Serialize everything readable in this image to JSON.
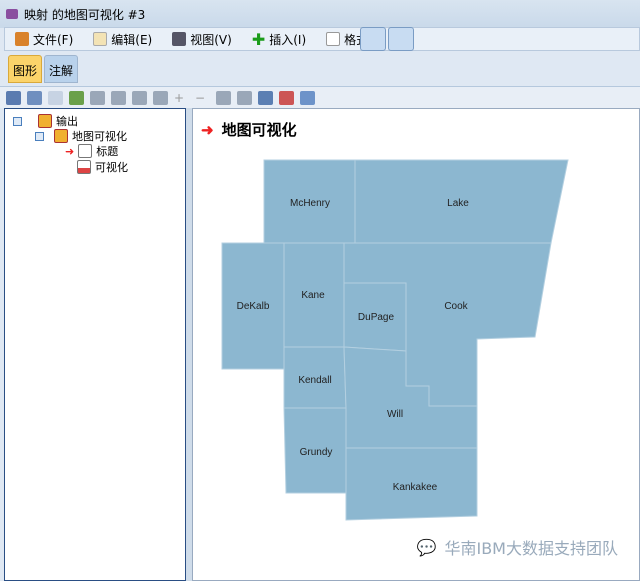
{
  "window": {
    "title": "映射 的地图可视化 #3"
  },
  "menu": [
    {
      "label": "文件(F)",
      "icon": "briefcase-icon"
    },
    {
      "label": "编辑(E)",
      "icon": "edit-icon"
    },
    {
      "label": "视图(V)",
      "icon": "flashlight-icon"
    },
    {
      "label": "插入(I)",
      "icon": "plus-icon"
    },
    {
      "label": "格式",
      "icon": "document-icon"
    }
  ],
  "tabs": [
    "图形",
    "注解"
  ],
  "tree": {
    "root": "输出",
    "child": "地图可视化",
    "items": [
      "标题",
      "可视化"
    ]
  },
  "main": {
    "heading": "地图可视化"
  },
  "map": {
    "counties": [
      "McHenry",
      "Lake",
      "DeKalb",
      "Kane",
      "DuPage",
      "Cook",
      "Kendall",
      "Will",
      "Grundy",
      "Kankakee"
    ],
    "fill": "#8cb7d0"
  },
  "watermark": "华南IBM大数据支持团队"
}
